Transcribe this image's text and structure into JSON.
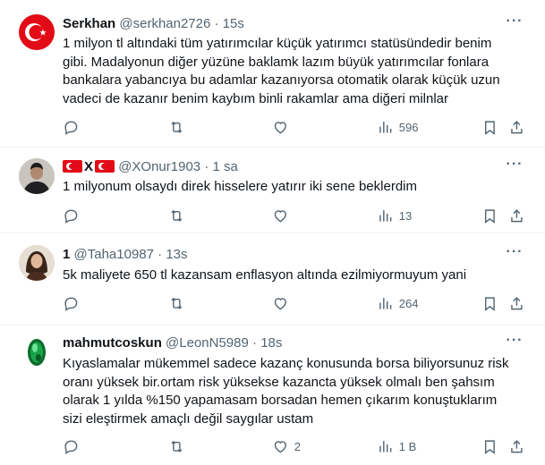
{
  "tweets": [
    {
      "name": "Serkhan",
      "handle": "@serkhan2726",
      "separator": "·",
      "time": "15s",
      "text_lines": [
        "1 milyon tl altındaki tüm yatırımcılar küçük yatırımcı statüsündedir benim",
        "gibi. Madalyonun diğer yüzüne baklamk lazım büyük yatırımcılar fonlara",
        "bankalara yabancıya bu adamlar kazanıyorsa otomatik olarak küçük uzun",
        "vadeci de kazanır benim kaybım binli rakamlar ama diğeri milnlar"
      ],
      "views": "596",
      "avatar": "turkish-flag-avatar"
    },
    {
      "name_mid": "X",
      "handle": "@XOnur1903",
      "separator": "·",
      "time": "1 sa",
      "text_lines": [
        "1 milyonum olsaydı direk hisselere yatırır iki sene beklerdim"
      ],
      "views": "13",
      "avatar": "man-photo-avatar"
    },
    {
      "name": "1",
      "handle": "@Taha10987",
      "separator": "·",
      "time": "13s",
      "text_lines": [
        "5k maliyete 650 tl kazansam enflasyon altında ezilmiyormuyum yani"
      ],
      "views": "264",
      "avatar": "woman-photo-avatar"
    },
    {
      "name": "mahmutcoskun",
      "handle": "@LeonN5989",
      "separator": "·",
      "time": "18s",
      "text_lines": [
        "Kıyaslamalar mükemmel sadece kazanç konusunda borsa biliyorsunuz risk",
        "oranı yüksek bir.ortam risk yüksekse kazancta yüksek olmalı ben şahsım",
        "olarak 1 yılda %150 yapamasam borsadan hemen çıkarım konuştuklarım",
        "sizi eleştirmek amaçlı değil saygılar ustam"
      ],
      "likes": "2",
      "views": "1 B",
      "avatar": "emerald-gem-avatar"
    }
  ],
  "more_label": "···",
  "colors": {
    "text": "#0f1419",
    "secondary": "#536471",
    "border": "#eff3f4",
    "flag_red": "#e30a17"
  }
}
